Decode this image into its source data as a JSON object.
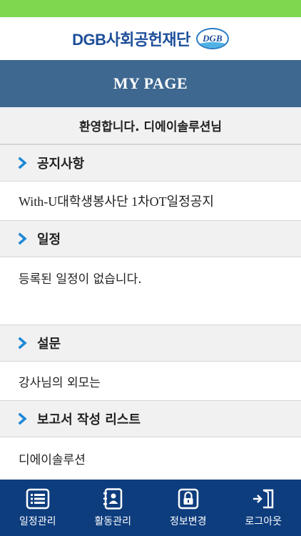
{
  "brand": {
    "name": "DGB사회공헌재단",
    "logo_text": "DGB"
  },
  "header": {
    "title": "MY PAGE"
  },
  "welcome": {
    "text": "환영합니다. 디에이솔루션님"
  },
  "sections": [
    {
      "id": "notice",
      "title": "공지사항",
      "icon": "chevron-right-icon",
      "content": "With-U대학생봉사단 1차OT일정공지"
    },
    {
      "id": "schedule",
      "title": "일정",
      "icon": "chevron-right-icon",
      "content": "등록된 일정이 없습니다."
    },
    {
      "id": "survey",
      "title": "설문",
      "icon": "chevron-right-icon",
      "content": "강사님의 외모는"
    },
    {
      "id": "report",
      "title": "보고서 작성 리스트",
      "icon": "chevron-right-icon",
      "content": "디에이솔루션"
    }
  ],
  "tabbar": {
    "items": [
      {
        "label": "일정관리",
        "icon": "list-icon"
      },
      {
        "label": "활동관리",
        "icon": "contact-book-icon"
      },
      {
        "label": "정보변경",
        "icon": "lock-icon"
      },
      {
        "label": "로그아웃",
        "icon": "logout-icon"
      }
    ]
  },
  "colors": {
    "status_bar": "#7fd74f",
    "header_bg": "#3e6890",
    "tabbar_bg": "#0e3d7e",
    "accent": "#1e88d6",
    "brand": "#1d4f9a"
  }
}
